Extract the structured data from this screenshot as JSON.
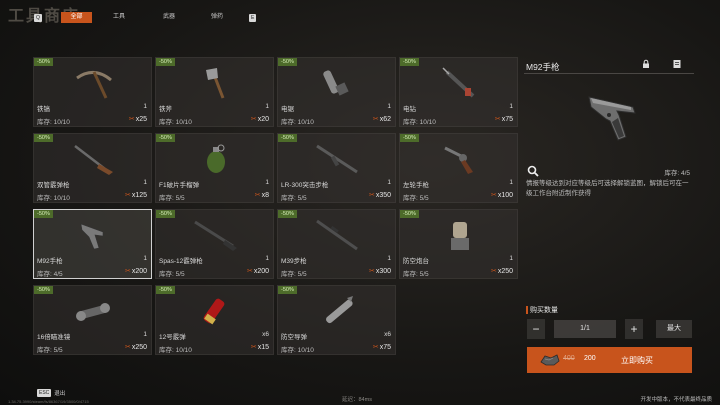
{
  "header": {
    "title": "工具商店",
    "left_key": "Q",
    "right_key": "E",
    "tabs": [
      {
        "label": "全部",
        "active": true
      },
      {
        "label": "工具",
        "active": false
      },
      {
        "label": "武器",
        "active": false
      },
      {
        "label": "弹药",
        "active": false
      }
    ]
  },
  "items": [
    {
      "name": "铁镐",
      "badge": "-50%",
      "qty": "1",
      "stock": "库存: 10/10",
      "price": "x25",
      "icon": "pickaxe-icon",
      "selected": false
    },
    {
      "name": "铁斧",
      "badge": "-50%",
      "qty": "1",
      "stock": "库存: 10/10",
      "price": "x20",
      "icon": "axe-icon",
      "selected": false
    },
    {
      "name": "电锯",
      "badge": "-50%",
      "qty": "1",
      "stock": "库存: 10/10",
      "price": "x62",
      "icon": "chainsaw-icon",
      "selected": false
    },
    {
      "name": "电钻",
      "badge": "-50%",
      "qty": "1",
      "stock": "库存: 10/10",
      "price": "x75",
      "icon": "drill-icon",
      "selected": false
    },
    {
      "name": "双管霰弹枪",
      "badge": "-50%",
      "qty": "1",
      "stock": "库存: 10/10",
      "price": "x125",
      "icon": "double-barrel-shotgun-icon",
      "selected": false
    },
    {
      "name": "F1破片手榴弹",
      "badge": "-50%",
      "qty": "1",
      "stock": "库存: 5/5",
      "price": "x8",
      "icon": "grenade-icon",
      "selected": false
    },
    {
      "name": "LR-300突击步枪",
      "badge": "-50%",
      "qty": "1",
      "stock": "库存: 5/5",
      "price": "x350",
      "icon": "assault-rifle-icon",
      "selected": false
    },
    {
      "name": "左轮手枪",
      "badge": "-50%",
      "qty": "1",
      "stock": "库存: 5/5",
      "price": "x100",
      "icon": "revolver-icon",
      "selected": false
    },
    {
      "name": "M92手枪",
      "badge": "-50%",
      "qty": "1",
      "stock": "库存: 4/5",
      "price": "x200",
      "icon": "pistol-icon",
      "selected": true
    },
    {
      "name": "Spas-12霰弹枪",
      "badge": "-50%",
      "qty": "1",
      "stock": "库存: 5/5",
      "price": "x200",
      "icon": "shotgun-icon",
      "selected": false
    },
    {
      "name": "M39步枪",
      "badge": "-50%",
      "qty": "1",
      "stock": "库存: 5/5",
      "price": "x300",
      "icon": "rifle-icon",
      "selected": false
    },
    {
      "name": "防空炮台",
      "badge": "-50%",
      "qty": "1",
      "stock": "库存: 5/5",
      "price": "x250",
      "icon": "sam-turret-icon",
      "selected": false
    },
    {
      "name": "16倍瞄准镜",
      "badge": "-50%",
      "qty": "1",
      "stock": "库存: 5/5",
      "price": "x250",
      "icon": "scope-icon",
      "selected": false
    },
    {
      "name": "12号霰弹",
      "badge": "-50%",
      "qty": "x6",
      "stock": "库存: 10/10",
      "price": "x15",
      "icon": "shotgun-shells-icon",
      "selected": false
    },
    {
      "name": "防空导弹",
      "badge": "-50%",
      "qty": "x6",
      "stock": "库存: 10/10",
      "price": "x75",
      "icon": "missile-icon",
      "selected": false
    }
  ],
  "detail": {
    "title": "M92手枪",
    "stock": "库存: 4/5",
    "description": "情报等级达到对应等级后可选择解锁蓝图，解锁后可在一级工作台附近制作获得"
  },
  "purchase": {
    "qty_label": "购买数量",
    "minus": "−",
    "qty_value": "1/1",
    "plus": "+",
    "max_label": "最大",
    "old_price": "400",
    "new_price": "200",
    "buy_label": "立即购买"
  },
  "footer": {
    "esc_key": "ESC",
    "esc_label": "退出",
    "build_info": "1.34.75.3990/steam/fs/86367/19/3500/0/4715",
    "latency": "延迟：84ms",
    "dev_note": "开发中版本，不代表最终品质"
  },
  "colors": {
    "accent": "#c8541c",
    "discount_badge": "#4d6b2a"
  }
}
